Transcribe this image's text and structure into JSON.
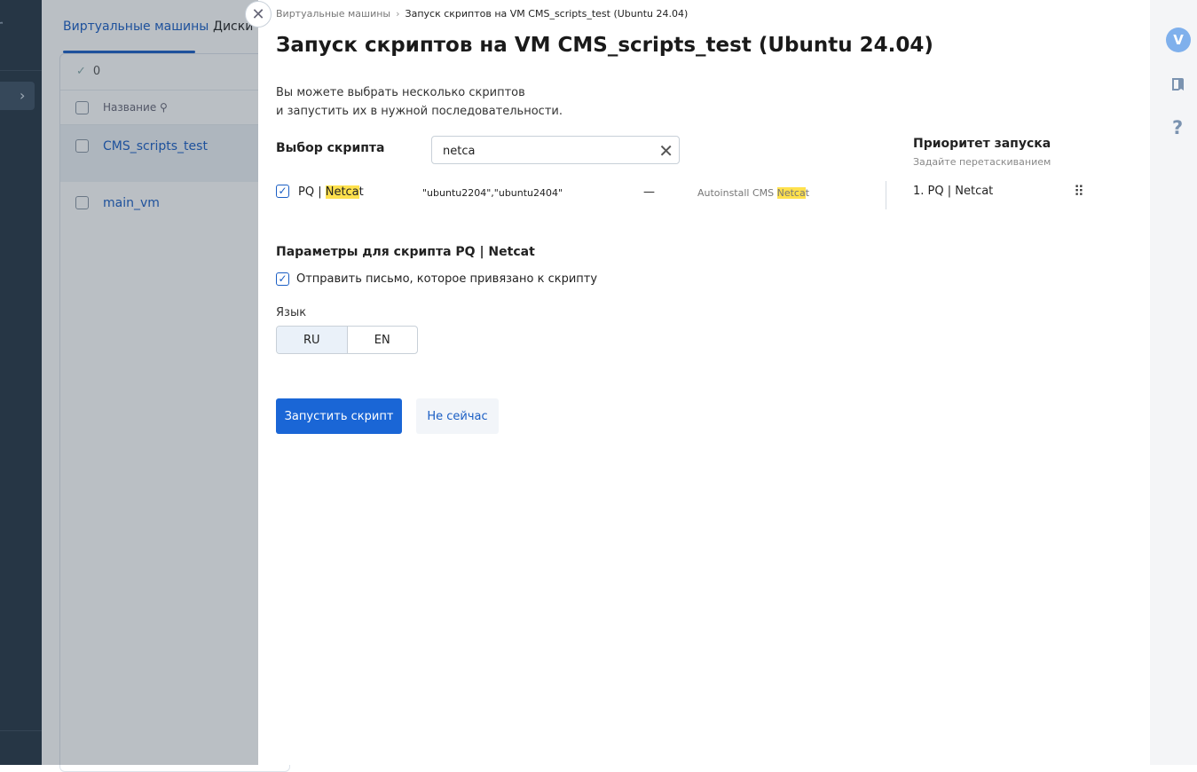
{
  "nav": {
    "logo_fragment": "r"
  },
  "background": {
    "tabs": [
      "Виртуальные машины",
      "Диски V"
    ],
    "selected_count": "0",
    "column_name": "Название",
    "rows": [
      "CMS_scripts_test",
      "main_vm"
    ]
  },
  "drawer": {
    "breadcrumb": {
      "parent": "Виртуальные машины",
      "current": "Запуск скриптов на VM CMS_scripts_test (Ubuntu 24.04)"
    },
    "title": "Запуск скриптов на VM CMS_scripts_test (Ubuntu 24.04)",
    "description_line1": "Вы можете выбрать несколько скриптов",
    "description_line2": "и запустить их в нужной последовательности.",
    "select_label": "Выбор скрипта",
    "search": {
      "value": "netca"
    },
    "script": {
      "name_prefix": "PQ | ",
      "name_match": "Netca",
      "name_suffix": "t",
      "os": "\"ubuntu2204\",\"ubuntu2404\"",
      "dash": "—",
      "desc_prefix": "Autoinstall CMS ",
      "desc_match": "Netca",
      "desc_suffix": "t",
      "checked": true
    },
    "priority": {
      "title": "Приоритет запуска",
      "hint": "Задайте перетаскиванием",
      "items": [
        "1.  PQ | Netcat"
      ]
    },
    "params_title": "Параметры для скрипта PQ | Netcat",
    "email_label": "Отправить письмо, которое привязано к скрипту",
    "lang_label": "Язык",
    "lang_options": [
      "RU",
      "EN"
    ],
    "lang_selected": "RU",
    "run_button": "Запустить скрипт",
    "cancel_button": "Не сейчас"
  },
  "rail": {
    "avatar_letter": "V",
    "help": "?"
  },
  "colors": {
    "primary": "#1a66d6",
    "nav_bg": "#263544",
    "highlight": "#ffe14d"
  }
}
